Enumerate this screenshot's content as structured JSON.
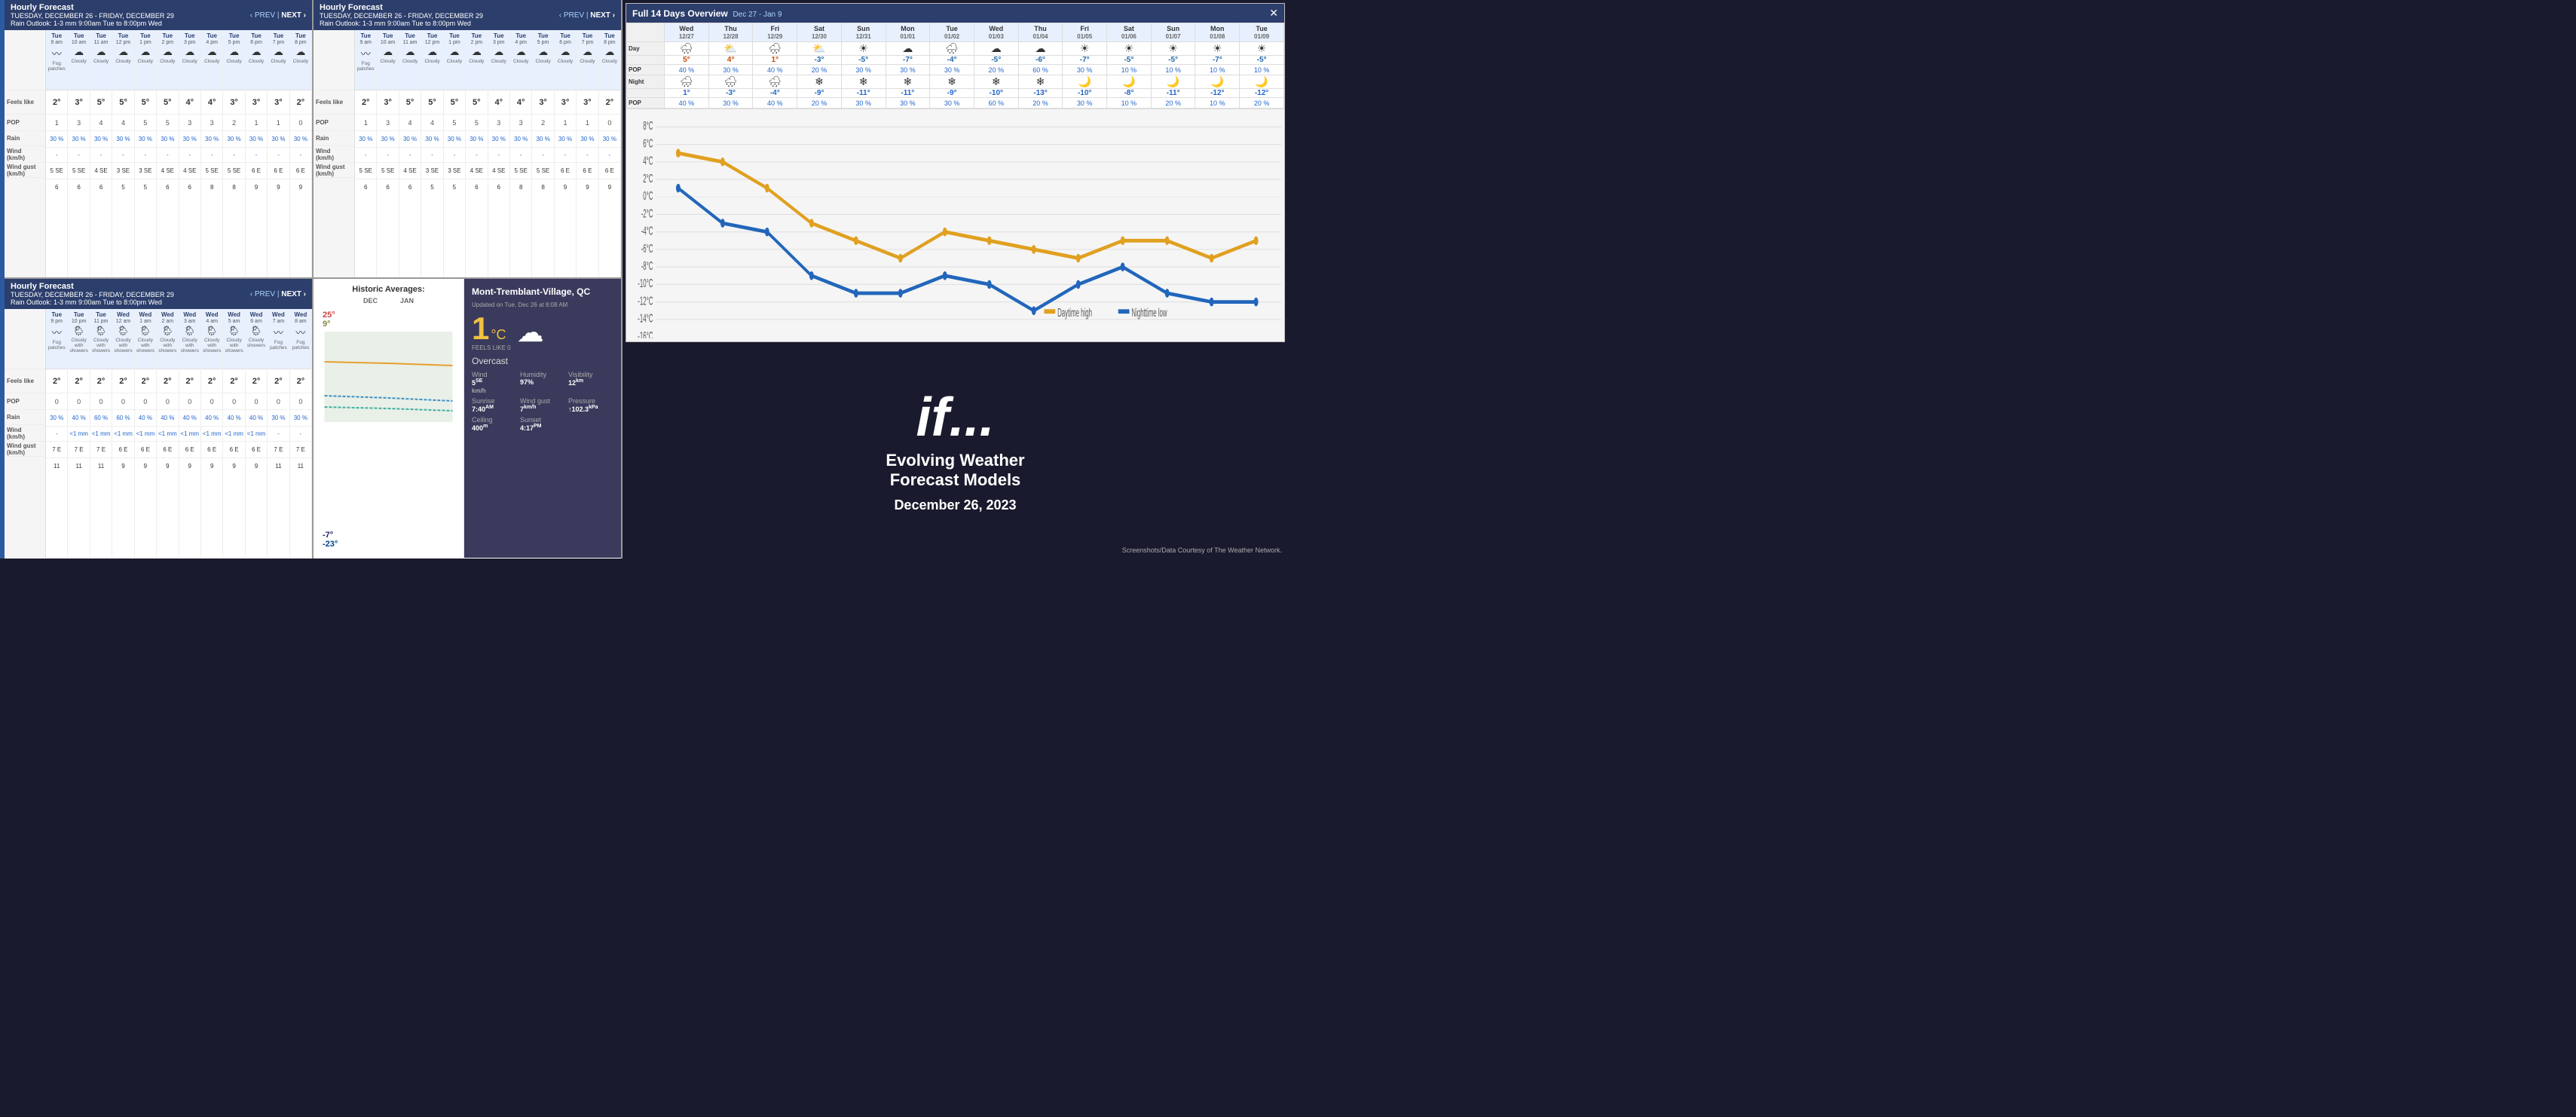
{
  "left_forecast_top": {
    "title": "Hourly Forecast",
    "subtitle": "TUESDAY, DECEMBER 26 - FRIDAY, DECEMBER 29",
    "rain_outlook": "Rain Outlook: 1-3 mm 9:00am Tue to 8:00pm Wed",
    "nav": "‹ PREV | NEXT ›",
    "row_labels": [
      "",
      "Feels like",
      "POP",
      "Rain",
      "Wind\n(km/h)",
      "Wind gust\n(km/h)"
    ],
    "hours": [
      {
        "day": "Tue",
        "time": "9 am",
        "desc": "Fog patches",
        "icon": "fog",
        "temp": "2°",
        "feels": "1",
        "pop": "30 %",
        "rain": "-",
        "wind": "5 SE",
        "gust": "6"
      },
      {
        "day": "Tue",
        "time": "10 am",
        "desc": "Cloudy",
        "icon": "cloud",
        "temp": "3°",
        "feels": "3",
        "pop": "30 %",
        "rain": "-",
        "wind": "5 SE",
        "gust": "6"
      },
      {
        "day": "Tue",
        "time": "11 am",
        "desc": "Cloudy",
        "icon": "cloud",
        "temp": "5°",
        "feels": "4",
        "pop": "30 %",
        "rain": "-",
        "wind": "4 SE",
        "gust": "6"
      },
      {
        "day": "Tue",
        "time": "12 pm",
        "desc": "Cloudy",
        "icon": "cloud",
        "temp": "5°",
        "feels": "4",
        "pop": "30 %",
        "rain": "-",
        "wind": "3 SE",
        "gust": "5"
      },
      {
        "day": "Tue",
        "time": "1 pm",
        "desc": "Cloudy",
        "icon": "cloud",
        "temp": "5°",
        "feels": "5",
        "pop": "30 %",
        "rain": "-",
        "wind": "3 SE",
        "gust": "5"
      },
      {
        "day": "Tue",
        "time": "2 pm",
        "desc": "Cloudy",
        "icon": "cloud",
        "temp": "5°",
        "feels": "5",
        "pop": "30 %",
        "rain": "-",
        "wind": "4 SE",
        "gust": "6"
      },
      {
        "day": "Tue",
        "time": "3 pm",
        "desc": "Cloudy",
        "icon": "cloud",
        "temp": "4°",
        "feels": "3",
        "pop": "30 %",
        "rain": "-",
        "wind": "4 SE",
        "gust": "6"
      },
      {
        "day": "Tue",
        "time": "4 pm",
        "desc": "Cloudy",
        "icon": "cloud",
        "temp": "4°",
        "feels": "3",
        "pop": "30 %",
        "rain": "-",
        "wind": "5 SE",
        "gust": "8"
      },
      {
        "day": "Tue",
        "time": "5 pm",
        "desc": "Cloudy",
        "icon": "cloud",
        "temp": "3°",
        "feels": "2",
        "pop": "30 %",
        "rain": "-",
        "wind": "5 SE",
        "gust": "8"
      },
      {
        "day": "Tue",
        "time": "6 pm",
        "desc": "Cloudy",
        "icon": "cloud",
        "temp": "3°",
        "feels": "1",
        "pop": "30 %",
        "rain": "-",
        "wind": "6 E",
        "gust": "9"
      },
      {
        "day": "Tue",
        "time": "7 pm",
        "desc": "Cloudy",
        "icon": "cloud",
        "temp": "3°",
        "feels": "1",
        "pop": "30 %",
        "rain": "-",
        "wind": "6 E",
        "gust": "9"
      },
      {
        "day": "Tue",
        "time": "8 pm",
        "desc": "Cloudy",
        "icon": "cloud",
        "temp": "2°",
        "feels": "0",
        "pop": "30 %",
        "rain": "-",
        "wind": "6 E",
        "gust": "9"
      }
    ]
  },
  "middle_forecast_top": {
    "title": "Hourly Forecast",
    "subtitle": "TUESDAY, DECEMBER 26 - FRIDAY, DECEMBER 29",
    "rain_outlook": "Rain Outlook: 1-3 mm 9:00am Tue to 8:00pm Wed",
    "nav_prev": "‹ PREV",
    "nav_next": "NEXT ›",
    "hours": [
      {
        "day": "Tue",
        "time": "9 pm",
        "desc": "Fog patches",
        "icon": "fog",
        "temp": "2°",
        "feels": "0",
        "pop": "30 %",
        "rain": "-",
        "wind": "7 E",
        "gust": "11"
      },
      {
        "day": "Tue",
        "time": "10 pm",
        "desc": "Cloudy with showers",
        "icon": "cloud-rain",
        "temp": "2°",
        "feels": "0",
        "pop": "40 %",
        "rain": "<1 mm",
        "wind": "7 E",
        "gust": "11"
      },
      {
        "day": "Tue",
        "time": "11 pm",
        "desc": "Cloudy with showers",
        "icon": "cloud-rain",
        "temp": "2°",
        "feels": "0",
        "pop": "60 %",
        "rain": "<1 mm",
        "wind": "7 E",
        "gust": "11"
      },
      {
        "day": "Wed",
        "time": "12 am",
        "desc": "Cloudy with showers",
        "icon": "cloud-rain",
        "temp": "2°",
        "feels": "0",
        "pop": "60 %",
        "rain": "<1 mm",
        "wind": "6 E",
        "gust": "9"
      },
      {
        "day": "Wed",
        "time": "1 am",
        "desc": "Cloudy with showers",
        "icon": "cloud-rain",
        "temp": "2°",
        "feels": "0",
        "pop": "40 %",
        "rain": "<1 mm",
        "wind": "6 E",
        "gust": "9"
      },
      {
        "day": "Wed",
        "time": "2 am",
        "desc": "Cloudy with showers",
        "icon": "cloud-rain",
        "temp": "2°",
        "feels": "0",
        "pop": "40 %",
        "rain": "<1 mm",
        "wind": "6 E",
        "gust": "9"
      },
      {
        "day": "Wed",
        "time": "3 am",
        "desc": "Cloudy with showers",
        "icon": "cloud-rain",
        "temp": "2°",
        "feels": "0",
        "pop": "40 %",
        "rain": "<1 mm",
        "wind": "6 E",
        "gust": "9"
      },
      {
        "day": "Wed",
        "time": "4 am",
        "desc": "Cloudy with showers",
        "icon": "cloud-rain",
        "temp": "2°",
        "feels": "0",
        "pop": "40 %",
        "rain": "<1 mm",
        "wind": "6 E",
        "gust": "9"
      },
      {
        "day": "Wed",
        "time": "5 am",
        "desc": "Cloudy with showers",
        "icon": "cloud-rain",
        "temp": "2°",
        "feels": "0",
        "pop": "40 %",
        "rain": "<1 mm",
        "wind": "6 E",
        "gust": "9"
      },
      {
        "day": "Wed",
        "time": "6 am",
        "desc": "Cloudy showers",
        "icon": "cloud-rain",
        "temp": "2°",
        "feels": "0",
        "pop": "40 %",
        "rain": "<1 mm",
        "wind": "6 E",
        "gust": "9"
      },
      {
        "day": "Wed",
        "time": "7 am",
        "desc": "Fog patches",
        "icon": "fog",
        "temp": "2°",
        "feels": "0",
        "pop": "30 %",
        "rain": "-",
        "wind": "7 E",
        "gust": "11"
      },
      {
        "day": "Wed",
        "time": "8 am",
        "desc": "Fog patches",
        "icon": "fog",
        "temp": "2°",
        "feels": "0",
        "pop": "30 %",
        "rain": "-",
        "wind": "7 E",
        "gust": "11"
      }
    ]
  },
  "overview_14day": {
    "title": "Full 14 Days Overview",
    "subtitle": "Dec 27 - Jan 9",
    "close": "✕",
    "columns": [
      {
        "day": "Wed",
        "date": "12/27"
      },
      {
        "day": "Thu",
        "date": "12/28"
      },
      {
        "day": "Fri",
        "date": "12/29"
      },
      {
        "day": "Sat",
        "date": "12/30"
      },
      {
        "day": "Sun",
        "date": "12/31"
      },
      {
        "day": "Mon",
        "date": "01/01"
      },
      {
        "day": "Tue",
        "date": "01/02"
      },
      {
        "day": "Wed",
        "date": "01/03"
      },
      {
        "day": "Thu",
        "date": "01/04"
      },
      {
        "day": "Fri",
        "date": "01/05"
      },
      {
        "day": "Sat",
        "date": "01/06"
      },
      {
        "day": "Sun",
        "date": "01/07"
      },
      {
        "day": "Mon",
        "date": "01/08"
      },
      {
        "day": "Tue",
        "date": "01/09"
      }
    ],
    "day_icons": [
      "🌧",
      "⛅",
      "🌧",
      "⛅",
      "☀",
      "☁",
      "🌧",
      "☁",
      "☁",
      "☀",
      "☀",
      "☀",
      "☀",
      "☀"
    ],
    "day_temps": [
      "5°",
      "4°",
      "1°",
      "-3°",
      "-5°",
      "-7°",
      "-4°",
      "-5°",
      "-6°",
      "-7°",
      "-5°",
      "-5°",
      "-7°",
      "-5°"
    ],
    "day_pop": [
      "40 %",
      "30 %",
      "40 %",
      "20 %",
      "30 %",
      "30 %",
      "30 %",
      "20 %",
      "60 %",
      "30 %",
      "10 %",
      "10 %",
      "10 %",
      "10 %"
    ],
    "night_icons": [
      "🌧",
      "🌧",
      "🌧",
      "❄",
      "❄",
      "❄",
      "❄",
      "❄",
      "❄",
      "🌙",
      "🌙",
      "🌙",
      "🌙",
      "🌙"
    ],
    "night_temps": [
      "1°",
      "-3°",
      "-4°",
      "-9°",
      "-11°",
      "-11°",
      "-9°",
      "-10°",
      "-13°",
      "-10°",
      "-8°",
      "-11°",
      "-12°",
      "-12°"
    ],
    "night_pop": [
      "40 %",
      "30 %",
      "40 %",
      "20 %",
      "30 %",
      "30 %",
      "30 %",
      "60 %",
      "20 %",
      "30 %",
      "10 %",
      "20 %",
      "10 %",
      "20 %"
    ],
    "chart": {
      "y_labels": [
        "8°C",
        "6°C",
        "4°C",
        "2°C",
        "0°C",
        "-2°C",
        "-4°C",
        "-6°C",
        "-8°C",
        "-10°C",
        "-12°C",
        "-14°C",
        "-16°C"
      ],
      "day_values": [
        5,
        4,
        1,
        -3,
        -5,
        -7,
        -4,
        -5,
        -6,
        -7,
        -5,
        -5,
        -7,
        -5
      ],
      "night_values": [
        1,
        -3,
        -4,
        -9,
        -11,
        -11,
        -9,
        -10,
        -13,
        -10,
        -8,
        -11,
        -12,
        -12
      ],
      "legend_day": "Daytime high",
      "legend_night": "Nighttime low"
    }
  },
  "historic": {
    "title": "Historic Averages:",
    "months": [
      "DEC",
      "JAN"
    ],
    "high": "25°",
    "avg_high": "9°",
    "avg_low": "-7°",
    "low": "-23°"
  },
  "current_weather": {
    "city": "Mont-Tremblant-Village, QC",
    "updated": "Updated on Tue, Dec 26 at 8:08 AM",
    "temp": "1",
    "unit": "°C",
    "feels_like_label": "FEELS LIKE",
    "feels_like": "0",
    "description": "Overcast",
    "wind_label": "Wind",
    "wind_value": "5",
    "wind_dir": "SE",
    "wind_unit": "km/h",
    "humidity_label": "Humidity",
    "humidity_value": "97%",
    "visibility_label": "Visibility",
    "visibility_value": "12",
    "visibility_unit": "km",
    "sunrise_label": "Sunrise",
    "sunrise_value": "7:40",
    "sunrise_suffix": "AM",
    "wind_gust_label": "Wind gust",
    "wind_gust_value": "7",
    "wind_gust_unit": "km/h",
    "pressure_label": "Pressure",
    "pressure_value": "↑102.3",
    "pressure_unit": "kPa",
    "ceiling_label": "Ceiling",
    "ceiling_value": "400",
    "ceiling_unit": "m",
    "sunset_label": "Sunset",
    "sunset_value": "4:17",
    "sunset_suffix": "PM"
  },
  "evolving": {
    "if_text": "if...",
    "title": "Evolving Weather\nForecast Models",
    "date": "December 26, 2023",
    "credit": "Screenshots/Data Courtesy of The Weather Network."
  }
}
